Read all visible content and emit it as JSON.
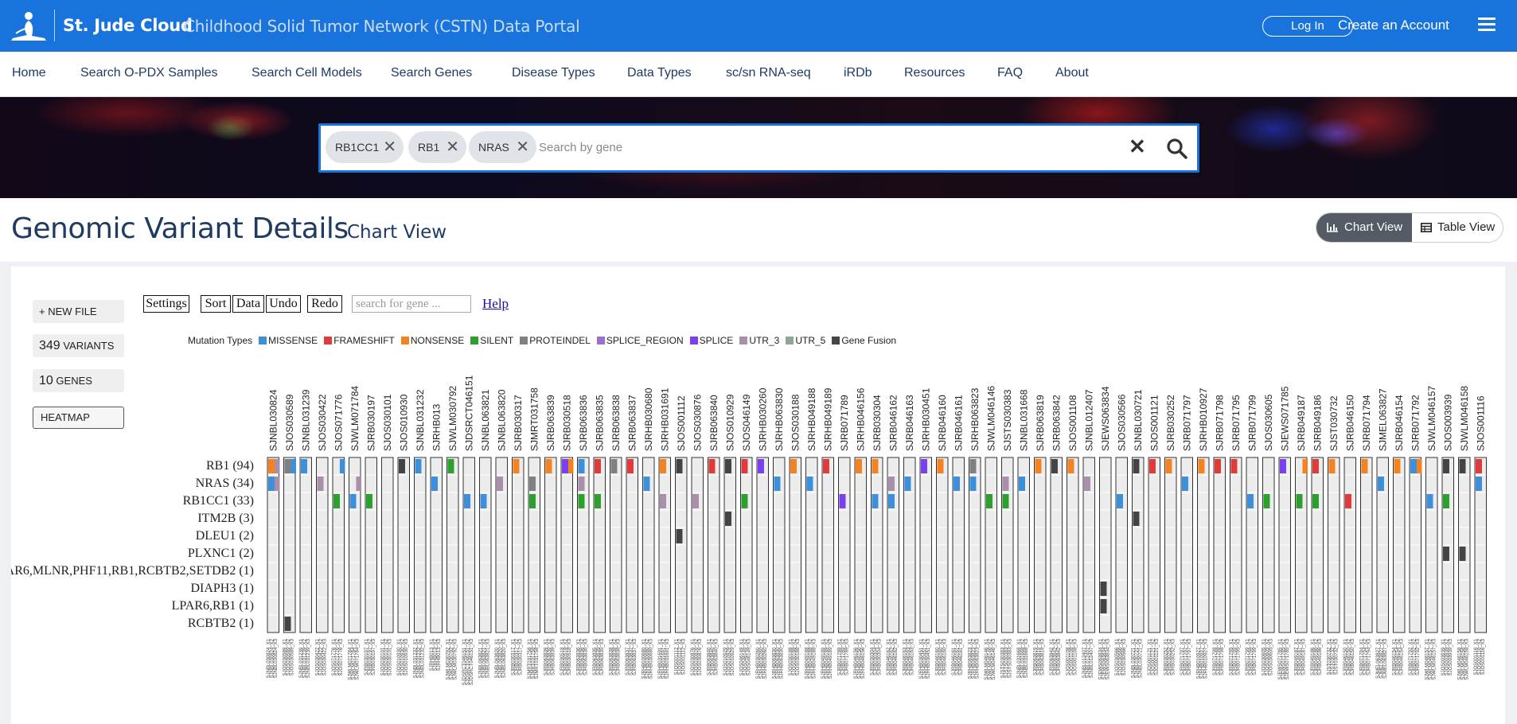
{
  "header": {
    "brand": "St. Jude Cloud",
    "brand_subtitle": "Childhood Solid Tumor Network (CSTN) Data Portal",
    "login": "Log In",
    "create_account": "Create an Account"
  },
  "nav": [
    "Home",
    "Search O-PDX Samples",
    "Search Cell Models",
    "Search Genes",
    "Disease Types",
    "Data Types",
    "sc/sn RNA-seq",
    "iRDb",
    "Resources",
    "FAQ",
    "About"
  ],
  "search": {
    "chips": [
      "RB1CC1",
      "RB1",
      "NRAS"
    ],
    "placeholder": "Search by gene"
  },
  "page": {
    "title": "Genomic Variant Details",
    "subtitle": "Chart View",
    "chart_view": "Chart View",
    "table_view": "Table View"
  },
  "sidebar": {
    "new_file": "+ NEW FILE",
    "variants_count": "349",
    "variants_label": "VARIANTS",
    "genes_count": "10",
    "genes_label": "GENES",
    "heatmap": "HEATMAP"
  },
  "toolbar": {
    "settings": "Settings",
    "sort": "Sort",
    "data": "Data",
    "undo": "Undo",
    "redo": "Redo",
    "gene_search_placeholder": "search for gene ...",
    "help": "Help"
  },
  "legend": {
    "title": "Mutation Types",
    "items": [
      {
        "label": "MISSENSE",
        "color": "#3b8fdb"
      },
      {
        "label": "FRAMESHIFT",
        "color": "#e03b3b"
      },
      {
        "label": "NONSENSE",
        "color": "#f5821f"
      },
      {
        "label": "SILENT",
        "color": "#2ca02c"
      },
      {
        "label": "PROTEINDEL",
        "color": "#808080"
      },
      {
        "label": "SPLICE_REGION",
        "color": "#9b6fd0"
      },
      {
        "label": "SPLICE",
        "color": "#7b3ff2"
      },
      {
        "label": "UTR_3",
        "color": "#a98fa9"
      },
      {
        "label": "UTR_5",
        "color": "#8fa895"
      },
      {
        "label": "Gene Fusion",
        "color": "#444444"
      }
    ]
  },
  "chart_data": {
    "type": "heatmap",
    "rows": [
      "RB1 (94)",
      "NRAS (34)",
      "RB1CC1 (33)",
      "ITM2B (3)",
      "DLEU1 (2)",
      "PLXNC1 (2)",
      "AR6,MLNR,PHF11,RB1,RCBTB2,SETDB2 (1)",
      "DIAPH3 (1)",
      "LPAR6,RB1 (1)",
      "RCBTB2 (1)"
    ],
    "samples": [
      "SJNBL030824",
      "SJOS030589",
      "SJNBL031239",
      "SJOS030422",
      "SJOS071776",
      "SJWLM071784",
      "SJRB030197",
      "SJOS030101",
      "SJOS010930",
      "SJNBL031232",
      "SJRHB013",
      "SJWLM030792",
      "SJDSRCT046151",
      "SJNBL063821",
      "SJNBL063820",
      "SJRB030317",
      "SJMRT031758",
      "SJRB063839",
      "SJRB030518",
      "SJRB063836",
      "SJRB063835",
      "SJRB063838",
      "SJRB063837",
      "SJRHB030680",
      "SJRHB031691",
      "SJOS001112",
      "SJOS030876",
      "SJRB063840",
      "SJOS010929",
      "SJOS046149",
      "SJRHB030260",
      "SJRHB063830",
      "SJOS030188",
      "SJRHB049188",
      "SJRHB049189",
      "SJRB071789",
      "SJRHB046156",
      "SJRB030304",
      "SJRB046162",
      "SJRB046163",
      "SJRHB030451",
      "SJRB046160",
      "SJRB046161",
      "SJRHB063823",
      "SJWLM046146",
      "SJSTS030383",
      "SJNBL031668",
      "SJRB063819",
      "SJRB063842",
      "SJOS001108",
      "SJNBL012407",
      "SJEWS063834",
      "SJOS030566",
      "SJNBL030721",
      "SJOS001121",
      "SJRB030252",
      "SJRB071797",
      "SJRHB010927",
      "SJRB071798",
      "SJRB071795",
      "SJRB071799",
      "SJOS030605",
      "SJEWS071785",
      "SJRB049187",
      "SJRB049186",
      "SJST030732",
      "SJRB046150",
      "SJRB071794",
      "SJMEL063827",
      "SJRB046154",
      "SJRB071792",
      "SJWLM046157",
      "SJOS003939",
      "SJWLM046158",
      "SJOS001116"
    ],
    "cells": [
      {
        "s": 0,
        "r": 0,
        "t": "NONSENSE"
      },
      {
        "s": 0,
        "r": 1,
        "t": "MISSENSE"
      },
      {
        "s": 0,
        "r": 0,
        "t": "UTR_3",
        "sub": 1
      },
      {
        "s": 0,
        "r": 1,
        "t": "UTR_3",
        "sub": 1
      },
      {
        "s": 1,
        "r": 0,
        "t": "PROTEINDEL"
      },
      {
        "s": 1,
        "r": 0,
        "t": "MISSENSE",
        "sub": 1
      },
      {
        "s": 1,
        "r": 9,
        "t": "Gene Fusion"
      },
      {
        "s": 2,
        "r": 0,
        "t": "MISSENSE"
      },
      {
        "s": 3,
        "r": 1,
        "t": "UTR_3"
      },
      {
        "s": 4,
        "r": 2,
        "t": "SILENT"
      },
      {
        "s": 4,
        "r": 0,
        "t": "FRAMESHIFT",
        "sub": 1
      },
      {
        "s": 4,
        "r": 0,
        "t": "MISSENSE",
        "sub": 1
      },
      {
        "s": 5,
        "r": 2,
        "t": "MISSENSE"
      },
      {
        "s": 5,
        "r": 1,
        "t": "UTR_3",
        "sub": 1
      },
      {
        "s": 6,
        "r": 2,
        "t": "SILENT"
      },
      {
        "s": 7,
        "r": 1,
        "t": "NONSENSE",
        "hide": 1
      },
      {
        "s": 8,
        "r": 0,
        "t": "Gene Fusion"
      },
      {
        "s": 9,
        "r": 0,
        "t": "MISSENSE"
      },
      {
        "s": 10,
        "r": 1,
        "t": "MISSENSE"
      },
      {
        "s": 11,
        "r": 0,
        "t": "SILENT"
      },
      {
        "s": 12,
        "r": 2,
        "t": "MISSENSE"
      },
      {
        "s": 13,
        "r": 2,
        "t": "MISSENSE"
      },
      {
        "s": 14,
        "r": 1,
        "t": "UTR_3"
      },
      {
        "s": 15,
        "r": 0,
        "t": "NONSENSE"
      },
      {
        "s": 16,
        "r": 1,
        "t": "PROTEINDEL"
      },
      {
        "s": 16,
        "r": 2,
        "t": "SILENT"
      },
      {
        "s": 17,
        "r": 0,
        "t": "NONSENSE"
      },
      {
        "s": 18,
        "r": 0,
        "t": "SPLICE"
      },
      {
        "s": 18,
        "r": 0,
        "t": "NONSENSE",
        "sub": 1
      },
      {
        "s": 19,
        "r": 0,
        "t": "MISSENSE"
      },
      {
        "s": 19,
        "r": 2,
        "t": "SILENT"
      },
      {
        "s": 19,
        "r": 1,
        "t": "UTR_3"
      },
      {
        "s": 20,
        "r": 0,
        "t": "FRAMESHIFT"
      },
      {
        "s": 20,
        "r": 2,
        "t": "SILENT"
      },
      {
        "s": 21,
        "r": 0,
        "t": "PROTEINDEL"
      },
      {
        "s": 22,
        "r": 0,
        "t": "FRAMESHIFT"
      },
      {
        "s": 23,
        "r": 1,
        "t": "MISSENSE"
      },
      {
        "s": 24,
        "r": 0,
        "t": "NONSENSE"
      },
      {
        "s": 24,
        "r": 2,
        "t": "UTR_3"
      },
      {
        "s": 25,
        "r": 0,
        "t": "Gene Fusion"
      },
      {
        "s": 25,
        "r": 4,
        "t": "Gene Fusion"
      },
      {
        "s": 26,
        "r": 2,
        "t": "UTR_3"
      },
      {
        "s": 27,
        "r": 0,
        "t": "FRAMESHIFT"
      },
      {
        "s": 28,
        "r": 0,
        "t": "Gene Fusion"
      },
      {
        "s": 28,
        "r": 3,
        "t": "Gene Fusion"
      },
      {
        "s": 29,
        "r": 0,
        "t": "FRAMESHIFT"
      },
      {
        "s": 29,
        "r": 2,
        "t": "SILENT"
      },
      {
        "s": 30,
        "r": 0,
        "t": "SPLICE"
      },
      {
        "s": 31,
        "r": 1,
        "t": "MISSENSE"
      },
      {
        "s": 32,
        "r": 0,
        "t": "NONSENSE"
      },
      {
        "s": 33,
        "r": 1,
        "t": "MISSENSE"
      },
      {
        "s": 34,
        "r": 0,
        "t": "FRAMESHIFT"
      },
      {
        "s": 35,
        "r": 2,
        "t": "SPLICE"
      },
      {
        "s": 36,
        "r": 0,
        "t": "NONSENSE"
      },
      {
        "s": 37,
        "r": 2,
        "t": "MISSENSE"
      },
      {
        "s": 37,
        "r": 0,
        "t": "NONSENSE"
      },
      {
        "s": 38,
        "r": 1,
        "t": "UTR_3"
      },
      {
        "s": 38,
        "r": 2,
        "t": "MISSENSE"
      },
      {
        "s": 39,
        "r": 1,
        "t": "MISSENSE"
      },
      {
        "s": 40,
        "r": 0,
        "t": "SPLICE"
      },
      {
        "s": 41,
        "r": 0,
        "t": "NONSENSE"
      },
      {
        "s": 42,
        "r": 1,
        "t": "MISSENSE"
      },
      {
        "s": 43,
        "r": 0,
        "t": "PROTEINDEL"
      },
      {
        "s": 43,
        "r": 1,
        "t": "MISSENSE"
      },
      {
        "s": 44,
        "r": 2,
        "t": "SILENT"
      },
      {
        "s": 45,
        "r": 1,
        "t": "UTR_3"
      },
      {
        "s": 45,
        "r": 2,
        "t": "SILENT"
      },
      {
        "s": 46,
        "r": 1,
        "t": "MISSENSE"
      },
      {
        "s": 47,
        "r": 0,
        "t": "NONSENSE"
      },
      {
        "s": 48,
        "r": 0,
        "t": "Gene Fusion"
      },
      {
        "s": 49,
        "r": 0,
        "t": "NONSENSE"
      },
      {
        "s": 50,
        "r": 1,
        "t": "UTR_3"
      },
      {
        "s": 51,
        "r": 7,
        "t": "Gene Fusion"
      },
      {
        "s": 51,
        "r": 8,
        "t": "Gene Fusion"
      },
      {
        "s": 52,
        "r": 2,
        "t": "MISSENSE"
      },
      {
        "s": 53,
        "r": 0,
        "t": "Gene Fusion"
      },
      {
        "s": 53,
        "r": 3,
        "t": "Gene Fusion"
      },
      {
        "s": 54,
        "r": 0,
        "t": "FRAMESHIFT"
      },
      {
        "s": 55,
        "r": 0,
        "t": "NONSENSE"
      },
      {
        "s": 56,
        "r": 1,
        "t": "MISSENSE"
      },
      {
        "s": 57,
        "r": 0,
        "t": "NONSENSE"
      },
      {
        "s": 58,
        "r": 0,
        "t": "FRAMESHIFT"
      },
      {
        "s": 59,
        "r": 0,
        "t": "FRAMESHIFT"
      },
      {
        "s": 60,
        "r": 2,
        "t": "MISSENSE"
      },
      {
        "s": 61,
        "r": 2,
        "t": "SILENT"
      },
      {
        "s": 62,
        "r": 0,
        "t": "SPLICE"
      },
      {
        "s": 63,
        "r": 2,
        "t": "SILENT"
      },
      {
        "s": 63,
        "r": 0,
        "t": "NONSENSE",
        "sub": 1
      },
      {
        "s": 64,
        "r": 2,
        "t": "SILENT"
      },
      {
        "s": 64,
        "r": 0,
        "t": "FRAMESHIFT"
      },
      {
        "s": 65,
        "r": 0,
        "t": "NONSENSE"
      },
      {
        "s": 66,
        "r": 2,
        "t": "FRAMESHIFT"
      },
      {
        "s": 67,
        "r": 0,
        "t": "NONSENSE"
      },
      {
        "s": 68,
        "r": 1,
        "t": "MISSENSE"
      },
      {
        "s": 69,
        "r": 0,
        "t": "NONSENSE"
      },
      {
        "s": 70,
        "r": 0,
        "t": "MISSENSE"
      },
      {
        "s": 70,
        "r": 0,
        "t": "NONSENSE",
        "sub": 1
      },
      {
        "s": 71,
        "r": 2,
        "t": "MISSENSE"
      },
      {
        "s": 72,
        "r": 0,
        "t": "Gene Fusion"
      },
      {
        "s": 72,
        "r": 2,
        "t": "SILENT"
      },
      {
        "s": 72,
        "r": 5,
        "t": "Gene Fusion"
      },
      {
        "s": 73,
        "r": 0,
        "t": "Gene Fusion"
      },
      {
        "s": 73,
        "r": 5,
        "t": "Gene Fusion"
      },
      {
        "s": 74,
        "r": 1,
        "t": "MISSENSE"
      },
      {
        "s": 74,
        "r": 0,
        "t": "FRAMESHIFT"
      }
    ]
  }
}
